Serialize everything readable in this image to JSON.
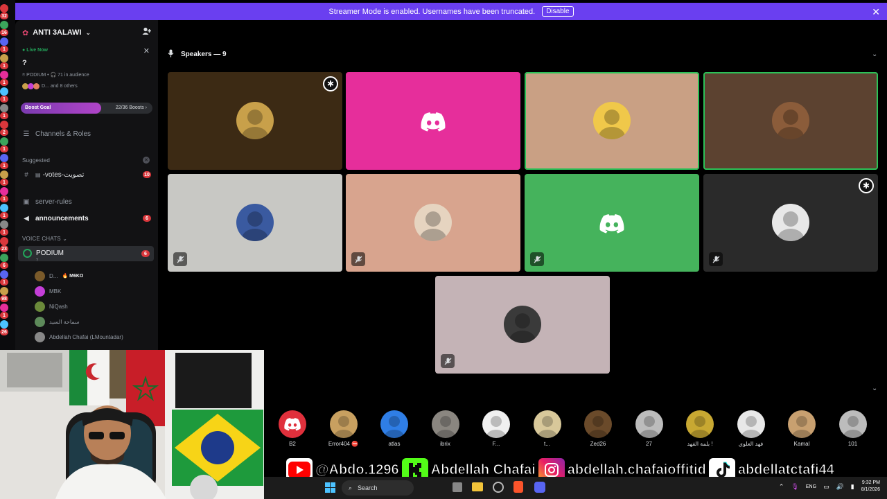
{
  "banner": {
    "text": "Streamer Mode is enabled. Usernames have been truncated.",
    "button": "Disable",
    "close_icon": "close-icon"
  },
  "rail": {
    "badges": [
      "32",
      "16",
      "1",
      "1",
      "1",
      "1",
      "1",
      "2",
      "1",
      "1",
      "1",
      "1",
      "1",
      "1",
      "23",
      "6",
      "1",
      "98",
      "1",
      "26"
    ]
  },
  "server": {
    "name": "ANTI 3ALAWI",
    "chevron": "chevron-down-icon",
    "add_member_icon": "add-user-icon"
  },
  "live": {
    "label": "Live Now",
    "title": "?",
    "meta": "PODIUM • 🎧 71 in audience",
    "others": "D... and 8 others"
  },
  "boost": {
    "label": "Boost Goal",
    "count": "22/36 Boosts ›",
    "progress": 0.61
  },
  "sidebar": {
    "channels_roles": "Channels & Roles",
    "suggested": "Suggested",
    "votes": "-votes-تصويت",
    "votes_badge": "10",
    "server_rules": "server-rules",
    "announcements": "announcements",
    "announcements_badge": "6",
    "voice_chats": "VOICE CHATS ⌄",
    "podium": "PODIUM",
    "podium_badge": "6",
    "podium_sub": "?",
    "voice_users": [
      {
        "name": "D...",
        "tag": "🔥 M6KO",
        "color": "#7a5a2a"
      },
      {
        "name": "MBK",
        "tag": "",
        "color": "#c43ed8"
      },
      {
        "name": "NiQash",
        "tag": "",
        "color": "#6b8a3a"
      },
      {
        "name": "سماحة السيد",
        "tag": "",
        "color": "#5d8a5a"
      },
      {
        "name": "Abdellah Chafai (LMountadar)",
        "tag": "",
        "color": "#888"
      }
    ]
  },
  "stage": {
    "speakers_label": "Speakers — 9",
    "speakers": [
      {
        "name": "speaker-1",
        "bg": "#3c2a14",
        "avatar": "#c8a04a",
        "mod": true,
        "muted": false,
        "active": false,
        "discord": false
      },
      {
        "name": "speaker-2",
        "bg": "#e62e9b",
        "avatar": "",
        "mod": false,
        "muted": false,
        "active": false,
        "discord": true
      },
      {
        "name": "speaker-3",
        "bg": "#c9a084",
        "avatar": "#f0c84a",
        "mod": false,
        "muted": false,
        "active": true,
        "discord": false
      },
      {
        "name": "speaker-4",
        "bg": "#5c4230",
        "avatar": "#8b5c3a",
        "mod": false,
        "muted": false,
        "active": true,
        "discord": false
      },
      {
        "name": "speaker-5",
        "bg": "#c8c8c4",
        "avatar": "#3a5aa0",
        "mod": false,
        "muted": true,
        "active": false,
        "discord": false
      },
      {
        "name": "speaker-6",
        "bg": "#d8a48e",
        "avatar": "#e6d4c0",
        "mod": false,
        "muted": true,
        "active": false,
        "discord": false
      },
      {
        "name": "speaker-7",
        "bg": "#45b35c",
        "avatar": "",
        "mod": false,
        "muted": true,
        "active": false,
        "discord": true
      },
      {
        "name": "speaker-8",
        "bg": "#2a2a2a",
        "avatar": "#e8e8e8",
        "mod": true,
        "muted": true,
        "active": false,
        "discord": false
      },
      {
        "name": "speaker-9",
        "bg": "#c4b3b6",
        "avatar": "#3a3a3a",
        "mod": false,
        "muted": true,
        "active": false,
        "discord": false
      }
    ]
  },
  "audience": [
    {
      "name": "B2",
      "color": "#e0303c",
      "discord": true
    },
    {
      "name": "Error404 ⛔",
      "color": "#c8a060"
    },
    {
      "name": "atlas",
      "color": "#2f7ee6"
    },
    {
      "name": "ibrix",
      "color": "#8a8680"
    },
    {
      "name": "F...",
      "color": "#f0f0f0"
    },
    {
      "name": "t...",
      "color": "#d8c89a"
    },
    {
      "name": "Zed26",
      "color": "#6a4a2a"
    },
    {
      "name": "27",
      "color": "#bcbcbc"
    },
    {
      "name": "بلمة الفهد !",
      "color": "#c8a832"
    },
    {
      "name": "فهد العلوي",
      "color": "#e8e8e8"
    },
    {
      "name": "Kamal",
      "color": "#c8a070"
    },
    {
      "name": "101",
      "color": "#bcbcbc"
    }
  ],
  "social": {
    "youtube": "@Abdo.1296",
    "kick": "Abdellah Chafai",
    "instagram": "abdellah.chafaioffitid",
    "tiktok": "abdellatctafi44"
  },
  "taskbar": {
    "search": "Search",
    "lang": "ENG",
    "time": "9:32 PM",
    "date": "8/1/2026"
  }
}
